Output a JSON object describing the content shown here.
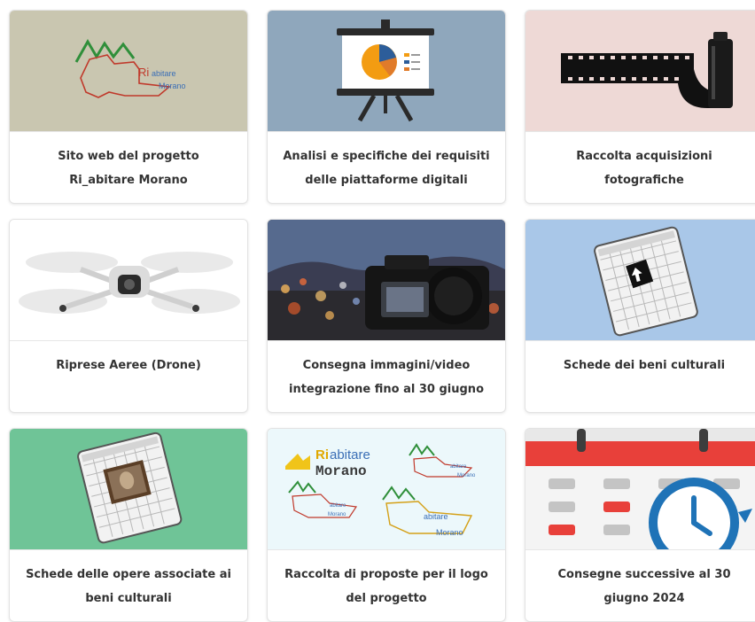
{
  "colors": {
    "card1_bg": "#c9c6b0",
    "card2_bg": "#8fa7bc",
    "card3_bg": "#eed9d6",
    "card4_bg": "#ffffff",
    "card5_bg": "#2b2a2f",
    "card6_bg": "#a9c7e8",
    "card7_bg": "#6fc497",
    "card8_bg": "#ecf8fb",
    "card9_bg": "#e8e8e8"
  },
  "cards": [
    {
      "icon": "ri-abitare-morano-map-logo",
      "title_lines": [
        "Sito web del progetto",
        "Ri_abitare Morano"
      ],
      "logo_text": {
        "ri": "Ri",
        "abitare": "abitare",
        "morano": "Morano"
      }
    },
    {
      "icon": "presentation-easel-pie-chart",
      "title_lines": [
        "Analisi e specifiche dei requisiti",
        "delle piattaforme digitali"
      ]
    },
    {
      "icon": "film-roll",
      "title_lines": [
        "Raccolta acquisizioni",
        "fotografiche"
      ]
    },
    {
      "icon": "drone",
      "title_lines": [
        "Riprese Aeree (Drone)"
      ]
    },
    {
      "icon": "camera-city-bokeh-photo",
      "title_lines": [
        "Consegna immagini/video",
        "integrazione fino al 30 giugno"
      ]
    },
    {
      "icon": "tablet-map-document",
      "title_lines": [
        "Schede dei beni culturali"
      ]
    },
    {
      "icon": "tablet-artwork-document",
      "title_lines": [
        "Schede delle opere associate ai",
        "beni culturali"
      ]
    },
    {
      "icon": "logo-proposals-collage",
      "title_lines": [
        "Raccolta di proposte per il logo",
        "del progetto"
      ],
      "logo_text": {
        "ri": "Ri",
        "abitare": "abitare",
        "morano": "Morano"
      }
    },
    {
      "icon": "calendar-clock",
      "title_lines": [
        "Consegne successive al 30",
        "giugno 2024"
      ]
    }
  ]
}
